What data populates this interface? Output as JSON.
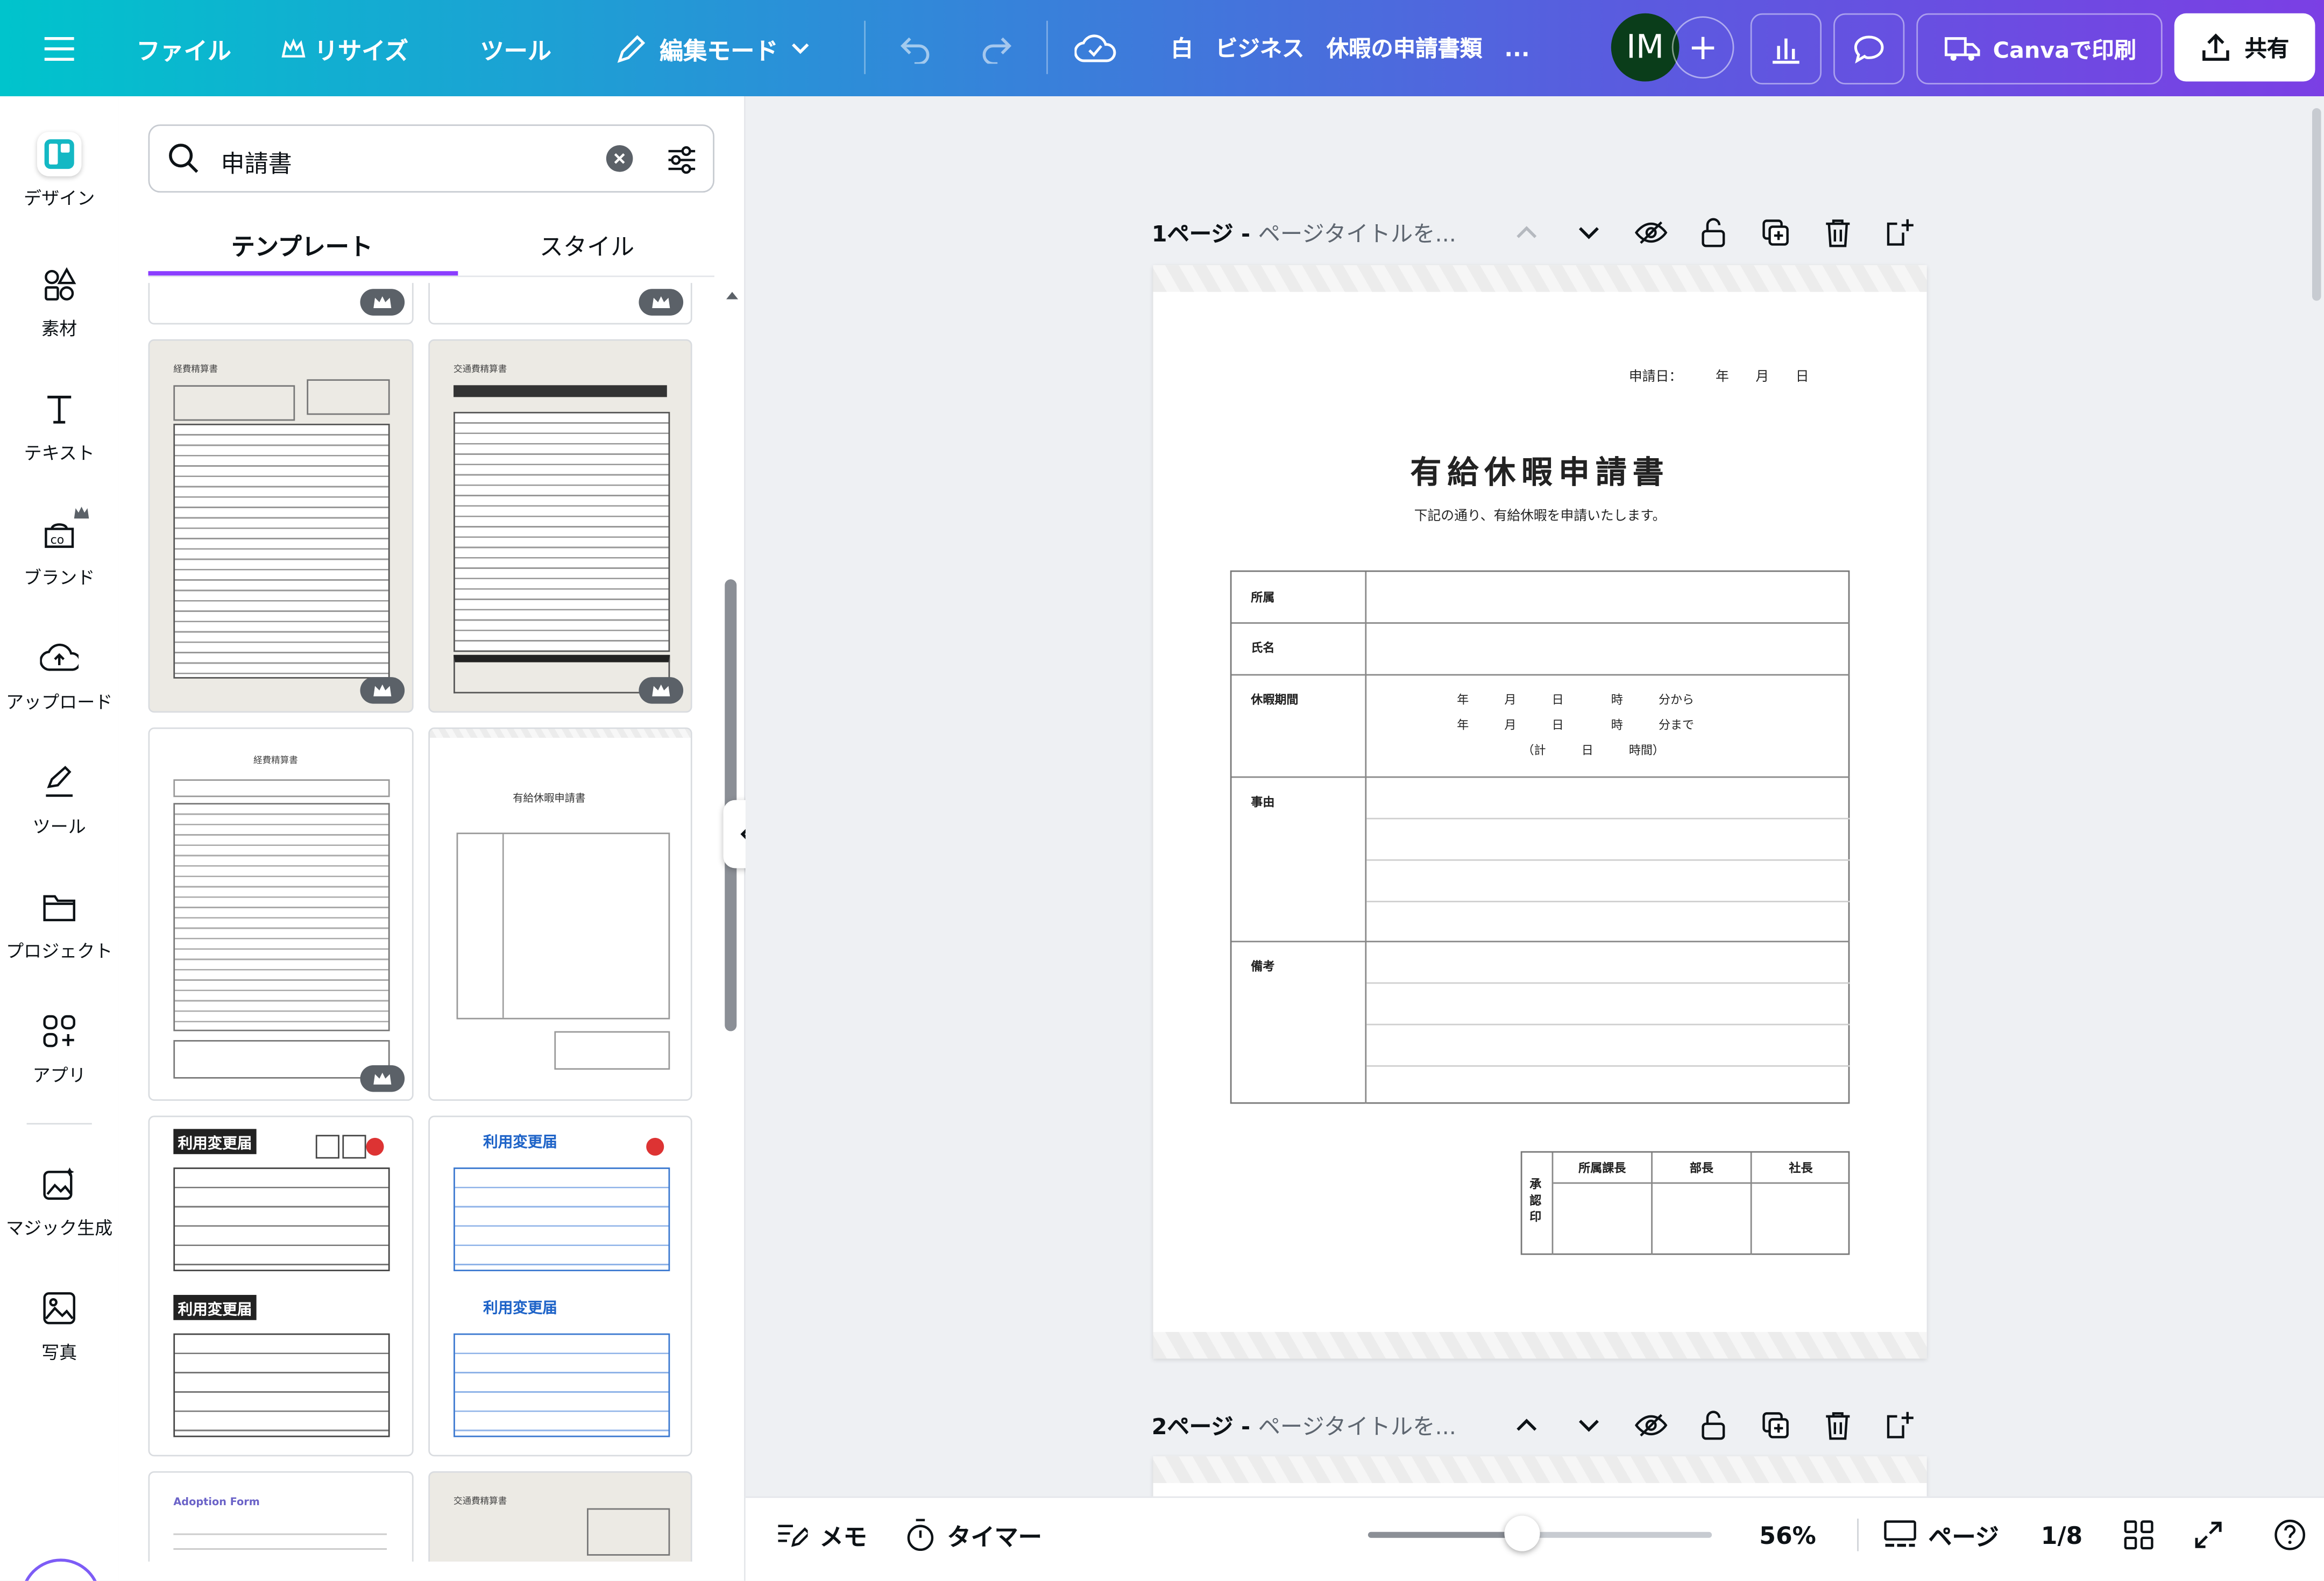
{
  "topbar": {
    "file": "ファイル",
    "resize": "リサイズ",
    "tools": "ツール",
    "edit_mode": "編集モード",
    "doc_title": "白　ビジネス　休暇の申請書類　...",
    "avatar": "IM",
    "print": "Canvaで印刷",
    "share": "共有"
  },
  "rail": {
    "design": "デザイン",
    "elements": "素材",
    "text": "テキスト",
    "brand": "ブランド",
    "upload": "アップロード",
    "tools": "ツール",
    "projects": "プロジェクト",
    "apps": "アプリ",
    "magic": "マジック生成",
    "photos": "写真"
  },
  "panel": {
    "search_value": "申請書",
    "tab_templates": "テンプレート",
    "tab_styles": "スタイル",
    "thumbs": {
      "expense": "経費精算書",
      "transport": "交通費精算書",
      "leave": "有給休暇申請書",
      "change": "利用変更届",
      "adoption": "Adoption Form"
    }
  },
  "page1": {
    "label": "1ページ - ",
    "title": "ページタイトルを..."
  },
  "page2": {
    "label": "2ページ - ",
    "title": "ページタイトルを..."
  },
  "doc": {
    "date": "申請日：　　　年　　月　　日",
    "title": "有給休暇申請書",
    "subtitle": "下記の通り、有給休暇を申請いたします。",
    "row_affiliation": "所属",
    "row_name": "氏名",
    "row_period": "休暇期間",
    "period_line1": "年　　　月　　　日　　　　時　　　分から",
    "period_line2": "年　　　月　　　日　　　　時　　　分まで",
    "period_line3": "（計　　　日　　　時間）",
    "row_reason": "事由",
    "row_note": "備考",
    "approval_label": "承認印",
    "approver_1": "所属課長",
    "approver_2": "部長",
    "approver_3": "社長"
  },
  "bottombar": {
    "notes": "メモ",
    "timer": "タイマー",
    "zoom": "56%",
    "zoom_fraction": 0.45,
    "pages": "ページ",
    "page_count": "1/8"
  }
}
